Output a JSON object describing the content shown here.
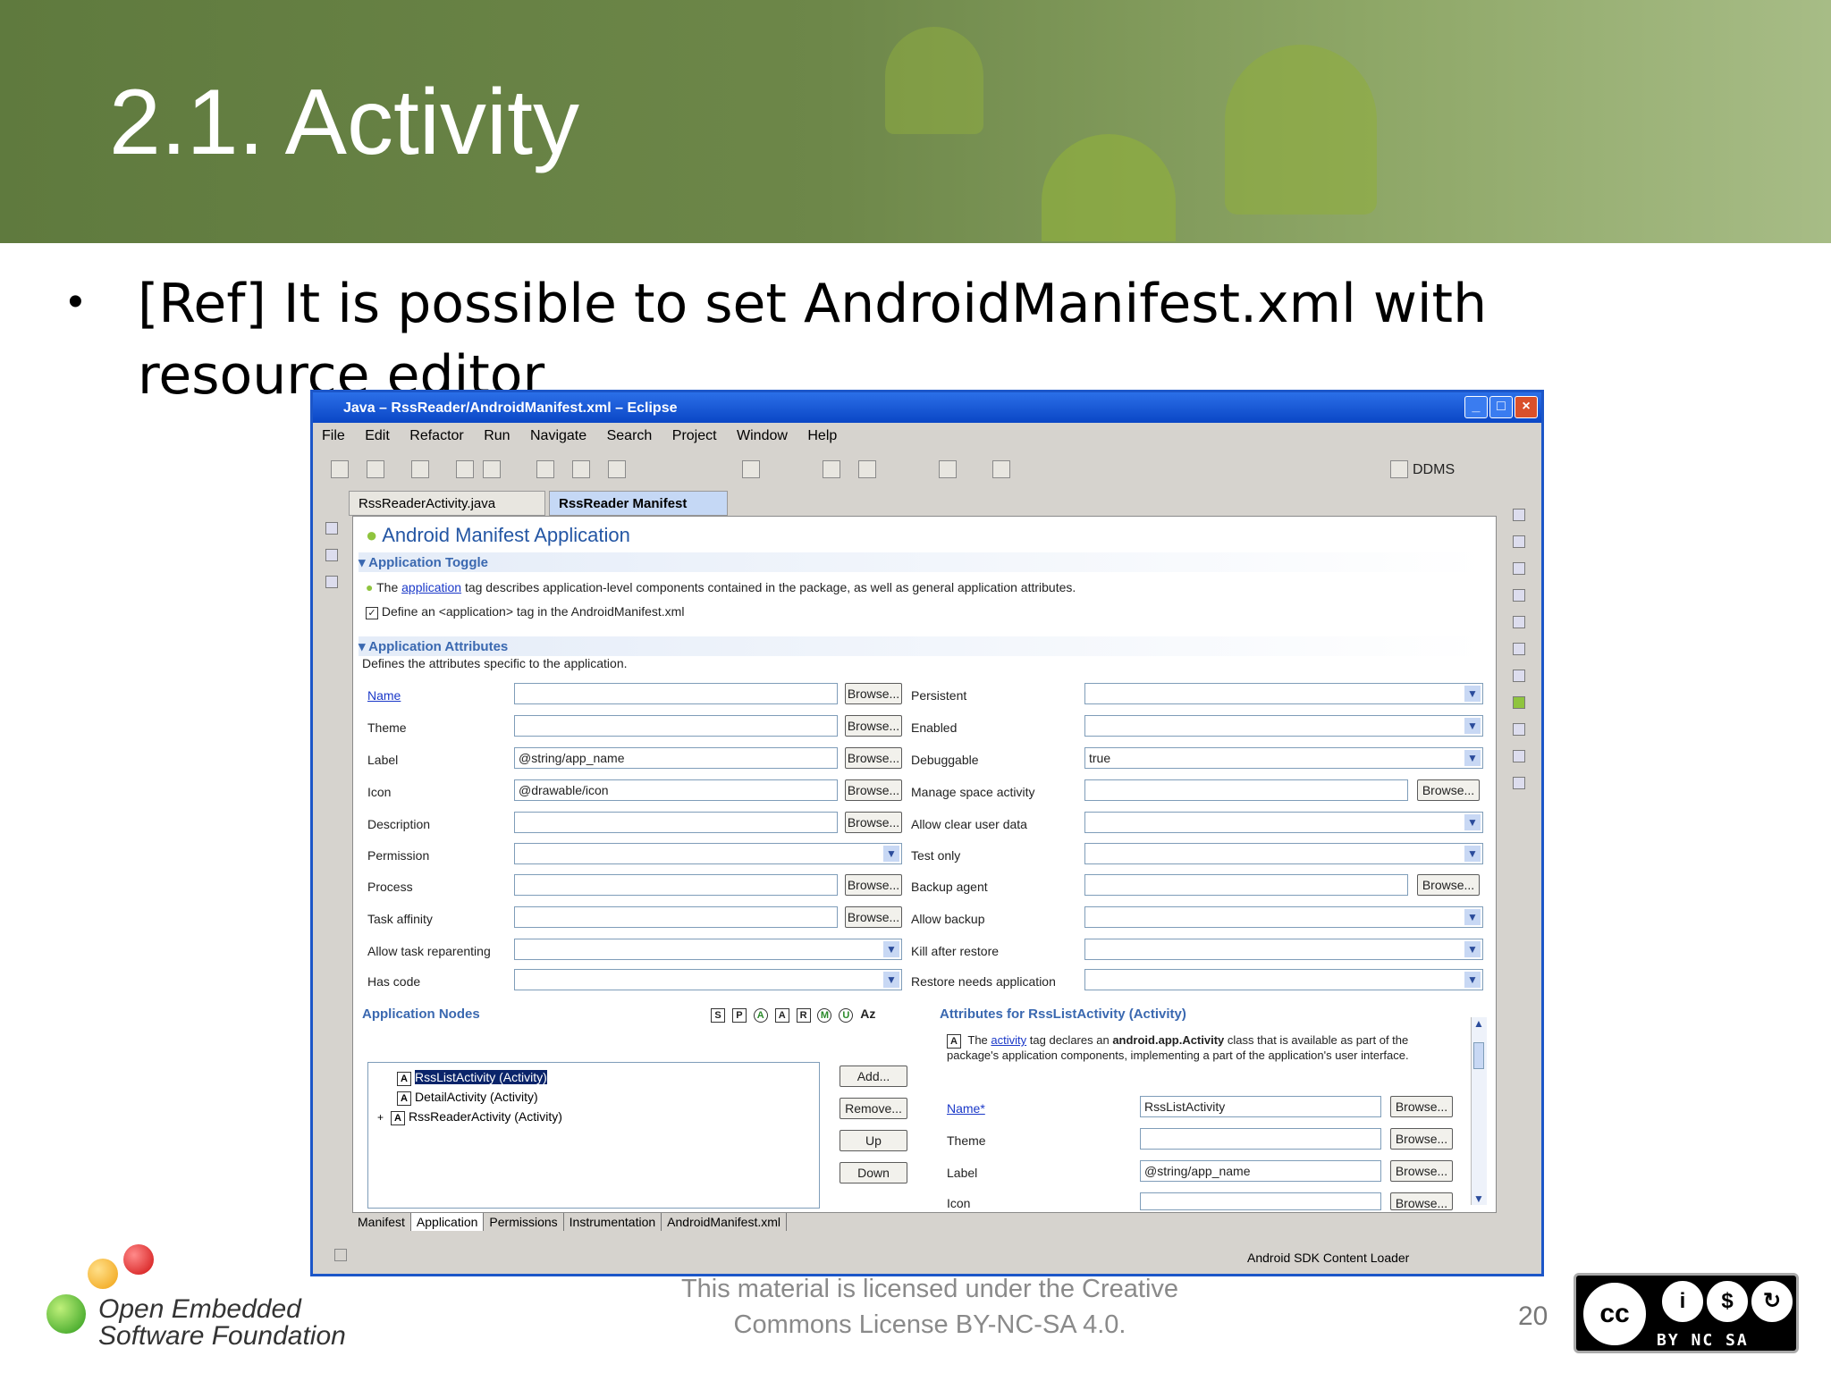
{
  "slide": {
    "title": "2.1. Activity",
    "bullet": "[Ref] It is possible to set AndroidManifest.xml  with resource editor",
    "license": "This material is licensed under the Creative Commons License BY-NC-SA 4.0.",
    "page_number": "20",
    "logo_text_line1": "Open Embedded",
    "logo_text_line2": "Software Foundation",
    "cc_labels": "BY  NC  SA"
  },
  "window": {
    "title": "Java – RssReader/AndroidManifest.xml – Eclipse",
    "menu": [
      "File",
      "Edit",
      "Refactor",
      "Run",
      "Navigate",
      "Search",
      "Project",
      "Window",
      "Help"
    ],
    "perspective": "DDMS",
    "tabs": [
      "RssReaderActivity.java",
      "RssReader Manifest"
    ],
    "status": "Android SDK Content Loader"
  },
  "editor": {
    "title": "Android Manifest Application",
    "toggle_section": "Application Toggle",
    "toggle_desc_pre": "The",
    "toggle_desc_link": "application",
    "toggle_desc_post": "tag describes application-level components contained in the package, as well as general application attributes.",
    "define_checkbox": "Define an <application> tag in the AndroidManifest.xml",
    "attributes_section": "Application Attributes",
    "attributes_desc": "Defines the attributes specific to the application.",
    "browse": "Browse...",
    "left_fields": [
      {
        "label": "Name",
        "value": ""
      },
      {
        "label": "Theme",
        "value": ""
      },
      {
        "label": "Label",
        "value": "@string/app_name"
      },
      {
        "label": "Icon",
        "value": "@drawable/icon"
      },
      {
        "label": "Description",
        "value": ""
      },
      {
        "label": "Permission",
        "value": ""
      },
      {
        "label": "Process",
        "value": ""
      },
      {
        "label": "Task affinity",
        "value": ""
      },
      {
        "label": "Allow task reparenting",
        "value": ""
      },
      {
        "label": "Has code",
        "value": ""
      }
    ],
    "right_fields": [
      {
        "label": "Persistent",
        "value": ""
      },
      {
        "label": "Enabled",
        "value": ""
      },
      {
        "label": "Debuggable",
        "value": "true"
      },
      {
        "label": "Manage space activity",
        "value": ""
      },
      {
        "label": "Allow clear user data",
        "value": ""
      },
      {
        "label": "Test only",
        "value": ""
      },
      {
        "label": "Backup agent",
        "value": ""
      },
      {
        "label": "Allow backup",
        "value": ""
      },
      {
        "label": "Kill after restore",
        "value": ""
      },
      {
        "label": "Restore needs application",
        "value": ""
      }
    ],
    "nodes_section": "Application Nodes",
    "node_badges": [
      "S",
      "P",
      "A",
      "A",
      "R",
      "M",
      "U",
      "Az"
    ],
    "nodes": [
      "RssListActivity (Activity)",
      "DetailActivity (Activity)",
      "RssReaderActivity (Activity)"
    ],
    "node_buttons": [
      "Add...",
      "Remove...",
      "Up",
      "Down"
    ],
    "detail_section": "Attributes for RssListActivity (Activity)",
    "detail_badge": "A",
    "detail_desc_pre": "The",
    "detail_desc_link": "activity",
    "detail_desc_mid": "tag declares an",
    "detail_desc_bold": "android.app.Activity",
    "detail_desc_post": "class that is available as part of the package's application components, implementing a part of the application's user interface.",
    "detail_fields": [
      {
        "label": "Name*",
        "value": "RssListActivity"
      },
      {
        "label": "Theme",
        "value": ""
      },
      {
        "label": "Label",
        "value": "@string/app_name"
      },
      {
        "label": "Icon",
        "value": ""
      }
    ],
    "bottom_tabs": [
      "Manifest",
      "Application",
      "Permissions",
      "Instrumentation",
      "AndroidManifest.xml"
    ]
  }
}
